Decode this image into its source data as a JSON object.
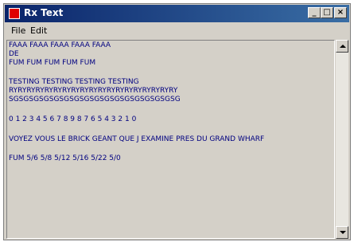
{
  "window": {
    "title": "Rx Text"
  },
  "menu": {
    "file": "File",
    "edit": "Edit"
  },
  "text_lines": [
    "FAAA FAAA FAAA FAAA FAAA",
    "DE",
    "FUM FUM FUM FUM FUM",
    "",
    "TESTING TESTING TESTING TESTING",
    "RYRYRYRYRYRYRYRYRYRYRYRYRYRYRYRYRYRYRY",
    "SGSGSGSGSGSGSGSGSGSGSGSGSGSGSGSGSG",
    "",
    "0 1 2 3 4 5 6 7 8 9 8 7 6 5 4 3 2 1 0",
    "",
    "VOYEZ VOUS LE BRICK GEANT QUE J EXAMINE PRES DU GRAND WHARF",
    "",
    "FUM 5/6 5/8 5/12 5/16 5/22 5/0"
  ]
}
